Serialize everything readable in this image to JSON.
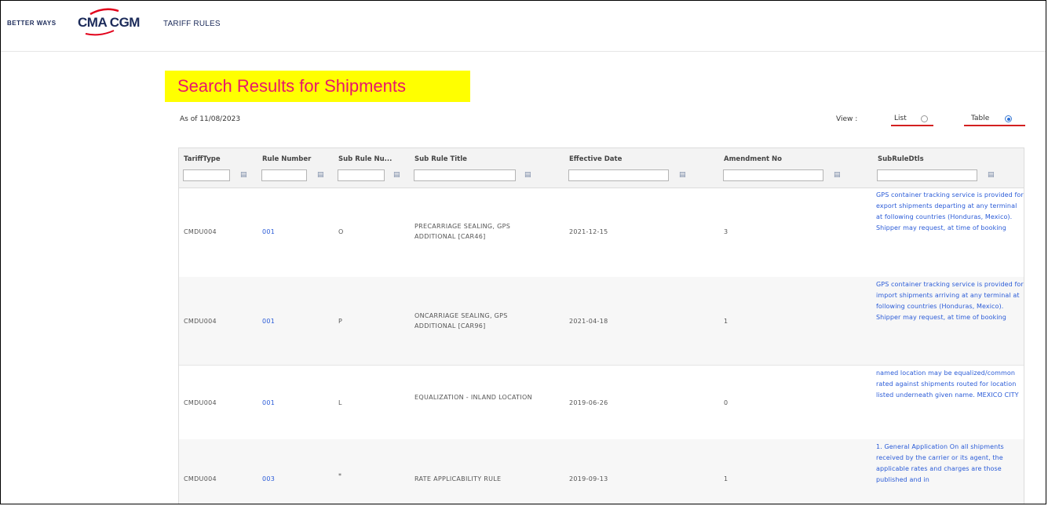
{
  "header": {
    "brand_tagline": "BETTER WAYS",
    "brand_name": "CMA CGM",
    "nav_link": "TARIFF RULES"
  },
  "page": {
    "title": "Search Results for Shipments",
    "as_of": "As of 11/08/2023",
    "view_label": "View :",
    "view_options": [
      {
        "label": "List",
        "selected": false
      },
      {
        "label": "Table",
        "selected": true
      }
    ]
  },
  "table": {
    "columns": [
      "TariffType",
      "Rule Number",
      "Sub Rule Nu...",
      "Sub Rule Title",
      "Effective Date",
      "Amendment No",
      "SubRuleDtls"
    ],
    "rows": [
      {
        "tariff_type": "CMDU004",
        "rule_number": "001",
        "sub_rule_number": "O",
        "sub_rule_title": "PRECARRIAGE SEALING, GPS ADDITIONAL [CAR46]",
        "effective_date": "2021-12-15",
        "amendment_no": "3",
        "sub_rule_dtls": "GPS container tracking service is provided for export shipments departing at any terminal at following countries (Honduras, Mexico). Shipper may request, at time of booking"
      },
      {
        "tariff_type": "CMDU004",
        "rule_number": "001",
        "sub_rule_number": "P",
        "sub_rule_title": "ONCARRIAGE SEALING, GPS ADDITIONAL [CAR96]",
        "effective_date": "2021-04-18",
        "amendment_no": "1",
        "sub_rule_dtls": "GPS container tracking service is provided for import shipments arriving at any terminal at following countries (Honduras, Mexico). Shipper may request, at time of booking"
      },
      {
        "tariff_type": "CMDU004",
        "rule_number": "001",
        "sub_rule_number": "L",
        "sub_rule_title": "EQUALIZATION - INLAND LOCATION",
        "effective_date": "2019-06-26",
        "amendment_no": "0",
        "sub_rule_dtls": "named location may be equalized/common rated against shipments routed for location listed underneath given name. MEXICO CITY"
      },
      {
        "tariff_type": "CMDU004",
        "rule_number": "003",
        "sub_rule_number": "*",
        "sub_rule_title": "RATE APPLICABILITY RULE",
        "effective_date": "2019-09-13",
        "amendment_no": "1",
        "sub_rule_dtls": "1. General Application On all shipments received by the carrier or its agent, the applicable rates and charges are those published and in"
      }
    ]
  },
  "colors": {
    "title_bg": "#ffff00",
    "title_text": "#e8176b",
    "link": "#2a5bd7",
    "brand": "#1c2b5a",
    "underline": "#d32020"
  }
}
